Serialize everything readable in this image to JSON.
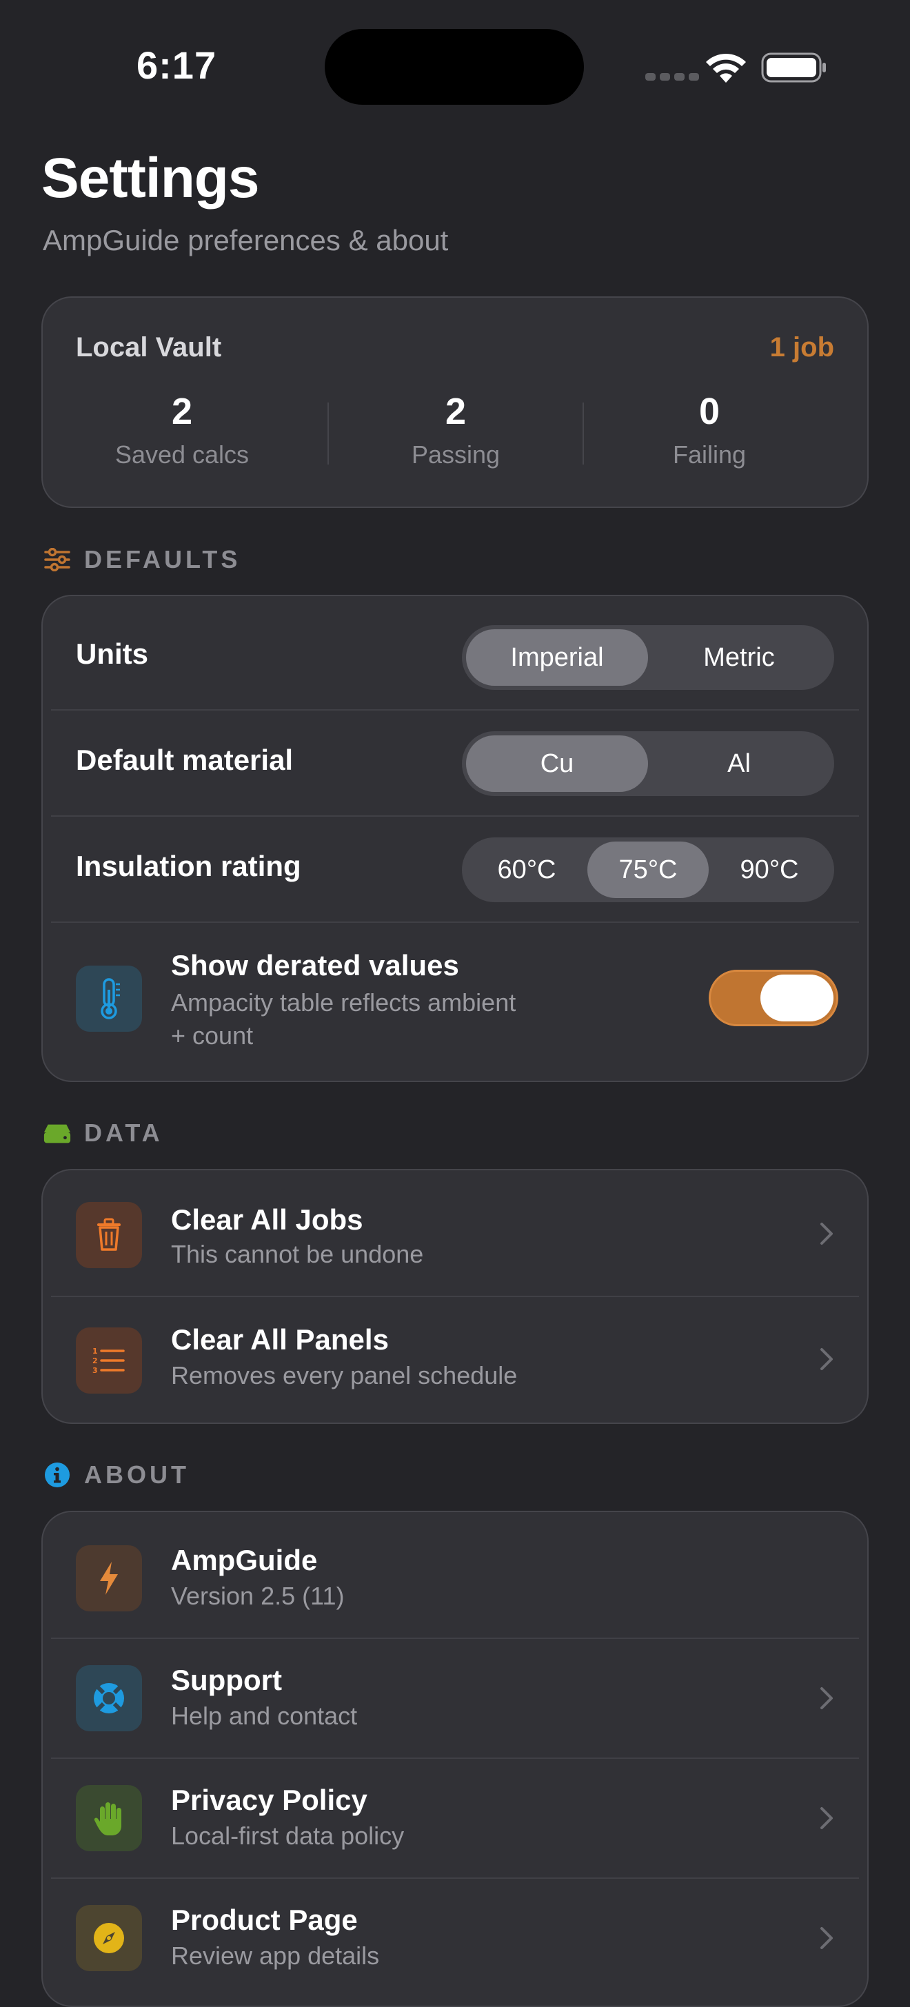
{
  "status_bar": {
    "time": "6:17"
  },
  "header": {
    "title": "Settings",
    "subtitle": "AmpGuide preferences & about"
  },
  "vault": {
    "title": "Local Vault",
    "badge": "1 job",
    "stats": [
      {
        "value": "2",
        "label": "Saved calcs"
      },
      {
        "value": "2",
        "label": "Passing"
      },
      {
        "value": "0",
        "label": "Failing"
      }
    ]
  },
  "defaults": {
    "section_label": "DEFAULTS",
    "section_icon": "sliders-icon",
    "units": {
      "label": "Units",
      "options": [
        "Imperial",
        "Metric"
      ],
      "selected": "Imperial"
    },
    "material": {
      "label": "Default material",
      "options": [
        "Cu",
        "Al"
      ],
      "selected": "Cu"
    },
    "insulation": {
      "label": "Insulation rating",
      "options": [
        "60°C",
        "75°C",
        "90°C"
      ],
      "selected": "75°C"
    },
    "derated": {
      "title": "Show derated values",
      "subtitle_line1": "Ampacity table reflects ambient",
      "subtitle_line2": "+ count",
      "icon": "thermometer-icon",
      "enabled": true
    }
  },
  "data_section": {
    "section_label": "DATA",
    "section_icon": "drive-icon",
    "items": [
      {
        "title": "Clear All Jobs",
        "subtitle": "This cannot be undone",
        "icon": "trash-icon"
      },
      {
        "title": "Clear All Panels",
        "subtitle": "Removes every panel schedule",
        "icon": "numbered-list-icon"
      }
    ]
  },
  "about_section": {
    "section_label": "ABOUT",
    "section_icon": "info-icon",
    "items": [
      {
        "title": "AmpGuide",
        "subtitle": "Version 2.5 (11)",
        "icon": "bolt-icon"
      },
      {
        "title": "Support",
        "subtitle": "Help and contact",
        "icon": "lifebuoy-icon"
      },
      {
        "title": "Privacy Policy",
        "subtitle": "Local-first data policy",
        "icon": "hand-icon"
      },
      {
        "title": "Product Page",
        "subtitle": "Review app details",
        "icon": "compass-icon"
      }
    ]
  },
  "colors": {
    "background": "#242428",
    "card": "#313136",
    "accent_orange": "#c07531",
    "badge_orange": "#c87c33",
    "info_blue": "#1e9be0",
    "data_green": "#6aa82a"
  }
}
